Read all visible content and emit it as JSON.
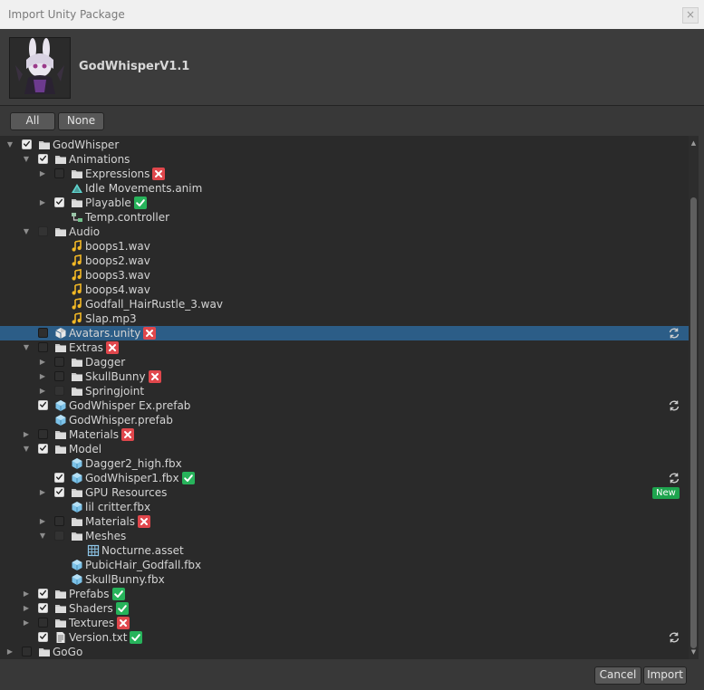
{
  "window": {
    "title": "Import Unity Package",
    "close_glyph": "×"
  },
  "package": {
    "name": "GodWhisperV1.1"
  },
  "toolbar": {
    "all_label": "All",
    "none_label": "None"
  },
  "footer": {
    "cancel_label": "Cancel",
    "import_label": "Import"
  },
  "tree": [
    {
      "label": "GodWhisper",
      "level": 0,
      "expander": "down",
      "check": "on",
      "icon": "folder"
    },
    {
      "label": "Animations",
      "level": 1,
      "expander": "down",
      "check": "on",
      "icon": "folder"
    },
    {
      "label": "Expressions",
      "level": 2,
      "expander": "right",
      "check": "off",
      "icon": "folder",
      "badge": "x"
    },
    {
      "label": "Idle Movements.anim",
      "level": 2,
      "expander": "none",
      "check": "none",
      "icon": "anim"
    },
    {
      "label": "Playable",
      "level": 2,
      "expander": "right",
      "check": "on",
      "icon": "folder",
      "badge": "ok"
    },
    {
      "label": "Temp.controller",
      "level": 2,
      "expander": "none",
      "check": "none",
      "icon": "controller"
    },
    {
      "label": "Audio",
      "level": 1,
      "expander": "down",
      "check": "dim",
      "icon": "folder"
    },
    {
      "label": "boops1.wav",
      "level": 2,
      "expander": "none",
      "check": "none",
      "icon": "audio"
    },
    {
      "label": "boops2.wav",
      "level": 2,
      "expander": "none",
      "check": "none",
      "icon": "audio"
    },
    {
      "label": "boops3.wav",
      "level": 2,
      "expander": "none",
      "check": "none",
      "icon": "audio"
    },
    {
      "label": "boops4.wav",
      "level": 2,
      "expander": "none",
      "check": "none",
      "icon": "audio"
    },
    {
      "label": "Godfall_HairRustle_3.wav",
      "level": 2,
      "expander": "none",
      "check": "none",
      "icon": "audio"
    },
    {
      "label": "Slap.mp3",
      "level": 2,
      "expander": "none",
      "check": "none",
      "icon": "audio"
    },
    {
      "label": "Avatars.unity",
      "level": 1,
      "expander": "none",
      "check": "off",
      "icon": "unity",
      "badge": "x",
      "selected": true,
      "swap": true
    },
    {
      "label": "Extras",
      "level": 1,
      "expander": "down",
      "check": "off",
      "icon": "folder",
      "badge": "x"
    },
    {
      "label": "Dagger",
      "level": 2,
      "expander": "right",
      "check": "off",
      "icon": "folder"
    },
    {
      "label": "SkullBunny",
      "level": 2,
      "expander": "right",
      "check": "off",
      "icon": "folder",
      "badge": "x"
    },
    {
      "label": "Springjoint",
      "level": 2,
      "expander": "right",
      "check": "dim",
      "icon": "folder"
    },
    {
      "label": "GodWhisper Ex.prefab",
      "level": 1,
      "expander": "none",
      "check": "on",
      "icon": "prefab",
      "swap": true
    },
    {
      "label": "GodWhisper.prefab",
      "level": 1,
      "expander": "none",
      "check": "none",
      "icon": "prefab"
    },
    {
      "label": "Materials",
      "level": 1,
      "expander": "right",
      "check": "off",
      "icon": "folder",
      "badge": "x"
    },
    {
      "label": "Model",
      "level": 1,
      "expander": "down",
      "check": "on",
      "icon": "folder"
    },
    {
      "label": "Dagger2_high.fbx",
      "level": 2,
      "expander": "none",
      "check": "none",
      "icon": "prefab"
    },
    {
      "label": "GodWhisper1.fbx",
      "level": 2,
      "expander": "none",
      "check": "on",
      "icon": "prefab",
      "badge": "ok",
      "swap": true
    },
    {
      "label": "GPU Resources",
      "level": 2,
      "expander": "right",
      "check": "on",
      "icon": "folder",
      "new": "New"
    },
    {
      "label": "lil critter.fbx",
      "level": 2,
      "expander": "none",
      "check": "none",
      "icon": "prefab"
    },
    {
      "label": "Materials",
      "level": 2,
      "expander": "right",
      "check": "off",
      "icon": "folder",
      "badge": "x"
    },
    {
      "label": "Meshes",
      "level": 2,
      "expander": "down",
      "check": "dim",
      "icon": "folder"
    },
    {
      "label": "Nocturne.asset",
      "level": 3,
      "expander": "none",
      "check": "none",
      "icon": "mesh"
    },
    {
      "label": "PubicHair_Godfall.fbx",
      "level": 2,
      "expander": "none",
      "check": "none",
      "icon": "prefab"
    },
    {
      "label": "SkullBunny.fbx",
      "level": 2,
      "expander": "none",
      "check": "none",
      "icon": "prefab"
    },
    {
      "label": "Prefabs",
      "level": 1,
      "expander": "right",
      "check": "on",
      "icon": "folder",
      "badge": "ok"
    },
    {
      "label": "Shaders",
      "level": 1,
      "expander": "right",
      "check": "on",
      "icon": "folder",
      "badge": "ok"
    },
    {
      "label": "Textures",
      "level": 1,
      "expander": "right",
      "check": "off",
      "icon": "folder",
      "badge": "x"
    },
    {
      "label": "Version.txt",
      "level": 1,
      "expander": "none",
      "check": "on",
      "icon": "text",
      "badge": "ok",
      "swap": true
    },
    {
      "label": "GoGo",
      "level": 0,
      "expander": "right",
      "check": "off",
      "icon": "folder"
    }
  ]
}
